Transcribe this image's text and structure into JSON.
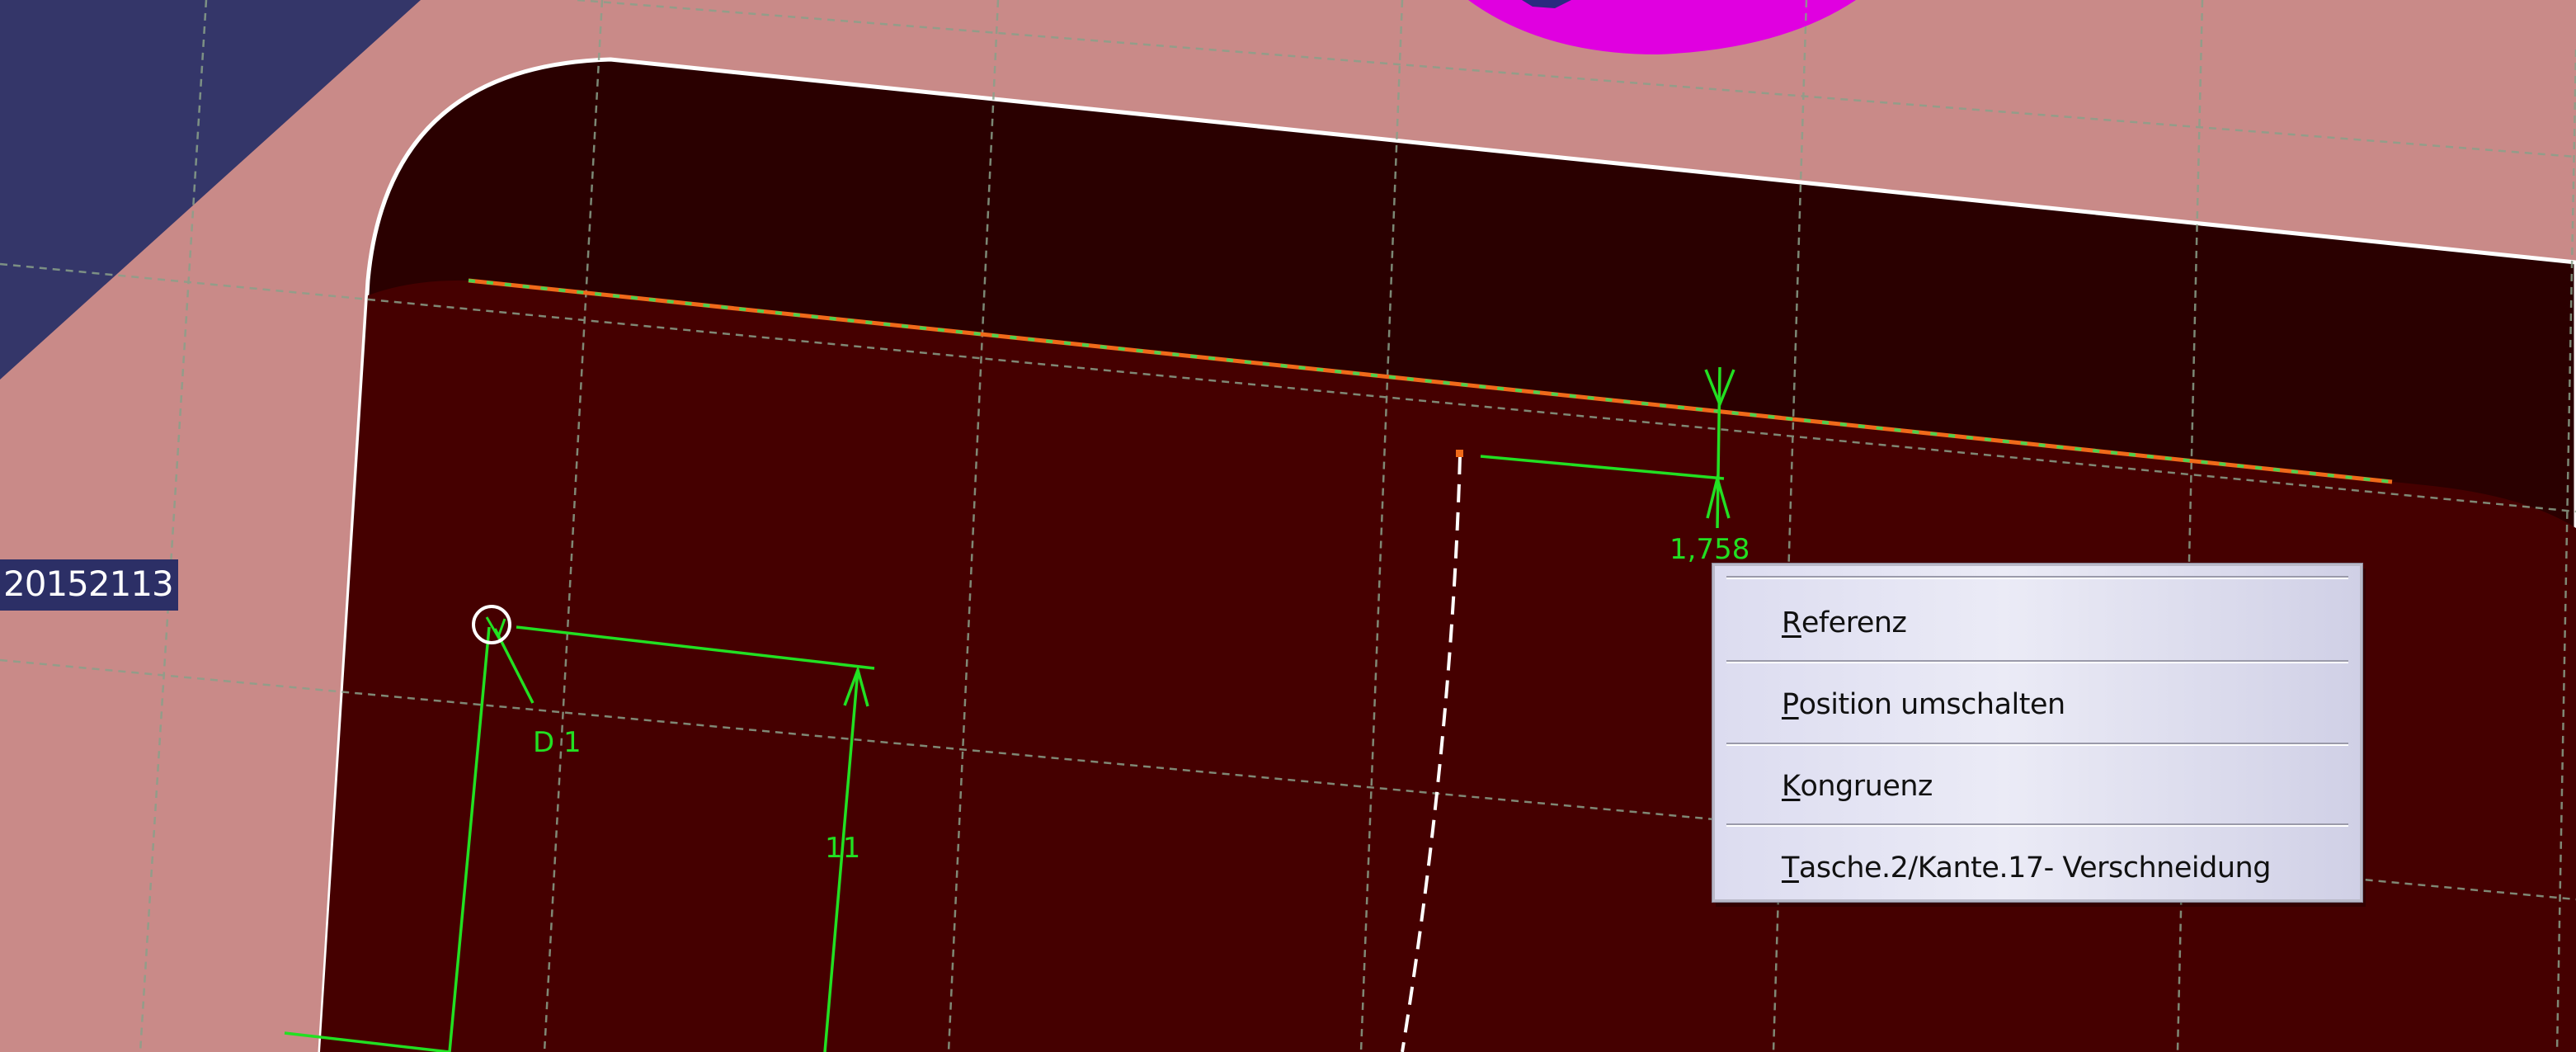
{
  "viewport": {
    "part_label": "20152113",
    "dimensions": {
      "d1_label": "D 1",
      "height_value": "11",
      "offset_value": "1,758"
    }
  },
  "context_menu": {
    "items": [
      {
        "mnemonic": "R",
        "rest": "eferenz"
      },
      {
        "mnemonic": "P",
        "rest": "osition umschalten"
      },
      {
        "mnemonic": "K",
        "rest": "ongruenz"
      },
      {
        "mnemonic": "T",
        "rest": "asche.2/Kante.17- Verschneidung"
      }
    ]
  },
  "colors": {
    "part_surface": "#c98a88",
    "pocket_dark": "#2a0000",
    "pocket_floor": "#450000",
    "navy_face": "#343669",
    "magenta_feature": "#e000e0",
    "constraint_green": "#22e022",
    "menu_background": "#e4e4f2"
  }
}
